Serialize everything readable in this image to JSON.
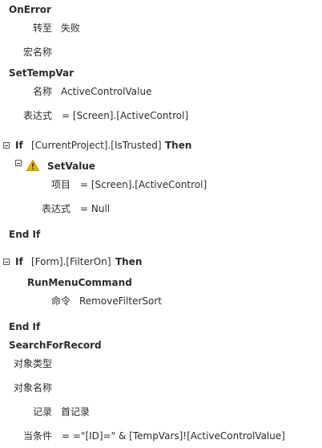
{
  "on_error": {
    "title": "OnError",
    "goto_label": "转至",
    "goto_value": "失败",
    "macro_name_label": "宏名称"
  },
  "set_temp_var": {
    "title": "SetTempVar",
    "name_label": "名称",
    "name_value": "ActiveControlValue",
    "expr_label": "表达式",
    "expr_value": "= [Screen].[ActiveControl]"
  },
  "if1": {
    "keyword": "If",
    "condition": "[CurrentProject].[IsTrusted]",
    "then": "Then",
    "set_value": {
      "title": "SetValue",
      "item_label": "项目",
      "item_value": "= [Screen].[ActiveControl]",
      "expr_label": "表达式",
      "expr_value": "= Null"
    },
    "end": "End If"
  },
  "if2": {
    "keyword": "If",
    "condition": "[Form].[FilterOn]",
    "then": "Then",
    "run_menu_command": {
      "title": "RunMenuCommand",
      "command_label": "命令",
      "command_value": "RemoveFilterSort"
    },
    "end": "End If"
  },
  "search_for_record": {
    "title": "SearchForRecord",
    "object_type_label": "对象类型",
    "object_name_label": "对象名称",
    "record_label": "记录",
    "record_value": "首记录",
    "where_label": "当条件",
    "where_value": "= =\"[ID]=\" & [TempVars]![ActiveControlValue]"
  },
  "icons": {
    "collapse": "collapse-toggle-icon",
    "warning": "warning-triangle-icon"
  },
  "colors": {
    "warning_fill": "#f0b400",
    "text": "#2b2b2b"
  }
}
